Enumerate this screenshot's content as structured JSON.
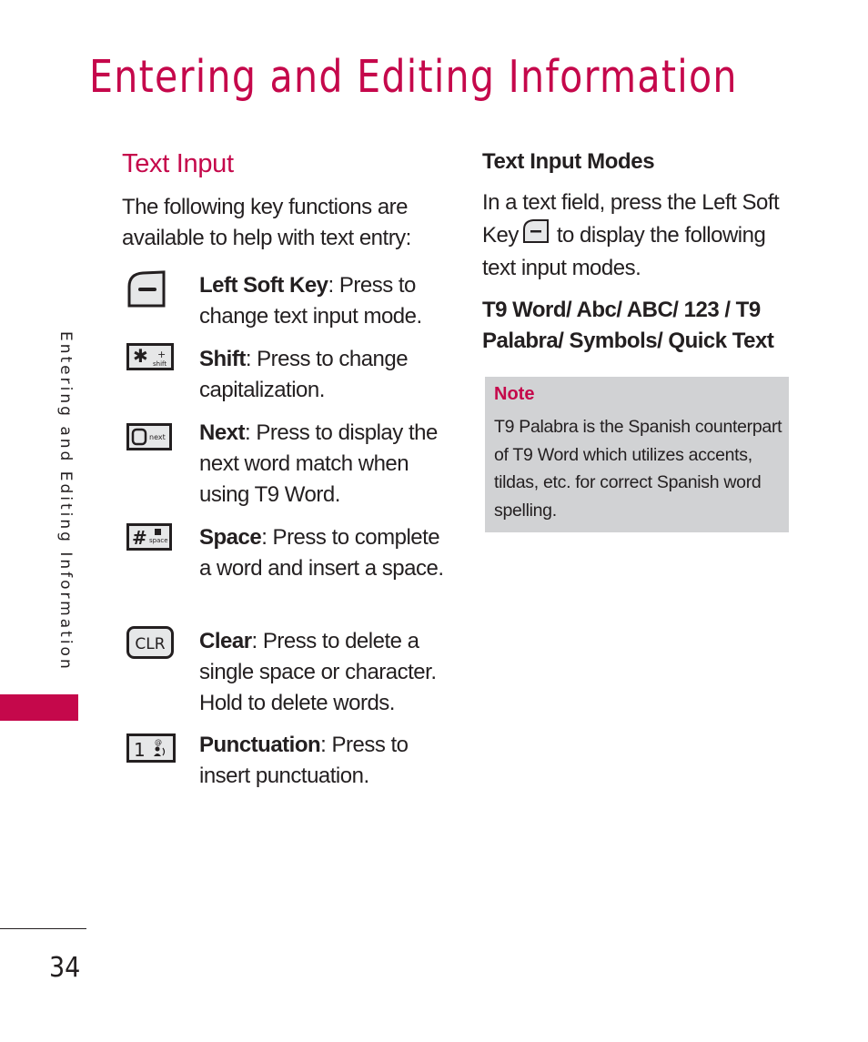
{
  "page": {
    "title": "Entering and Editing Information",
    "side_label": "Entering and Editing Information",
    "page_number": "34",
    "accent_color": "#c5084b"
  },
  "text_input": {
    "heading": "Text Input",
    "intro": "The following key functions are available to help with text entry:",
    "keys": [
      {
        "icon": "left-soft-key-icon",
        "name": "Left Soft Key",
        "desc": ": Press to change text input mode."
      },
      {
        "icon": "shift-key-icon",
        "glyph": "✱",
        "sub": "shift",
        "name": "Shift",
        "desc": ": Press to change capitalization."
      },
      {
        "icon": "next-key-icon",
        "glyph": "0",
        "sub": "next",
        "name": "Next",
        "desc": ": Press to display the next word match when using T9 Word."
      },
      {
        "icon": "space-key-icon",
        "glyph": "#",
        "sub": "space",
        "name": "Space",
        "desc": ": Press to complete a word and insert a space."
      },
      {
        "icon": "clear-key-icon",
        "glyph": "CLR",
        "name": "Clear",
        "desc": ": Press to delete a single space or character. Hold to delete words."
      },
      {
        "icon": "punctuation-key-icon",
        "glyph": "1",
        "sub": "@",
        "name": "Punctuation",
        "desc": ": Press to insert punctuation."
      }
    ]
  },
  "text_input_modes": {
    "heading": "Text Input Modes",
    "para_before": "In a text field, press the Left Soft Key",
    "para_after": "to display the following text input modes.",
    "modes": "T9 Word/ Abc/ ABC/ 123 / T9 Palabra/ Symbols/ Quick Text"
  },
  "note": {
    "title": "Note",
    "body": "T9 Palabra is the Spanish counterpart of T9 Word which utilizes accents, tildas, etc. for correct Spanish word spelling."
  }
}
